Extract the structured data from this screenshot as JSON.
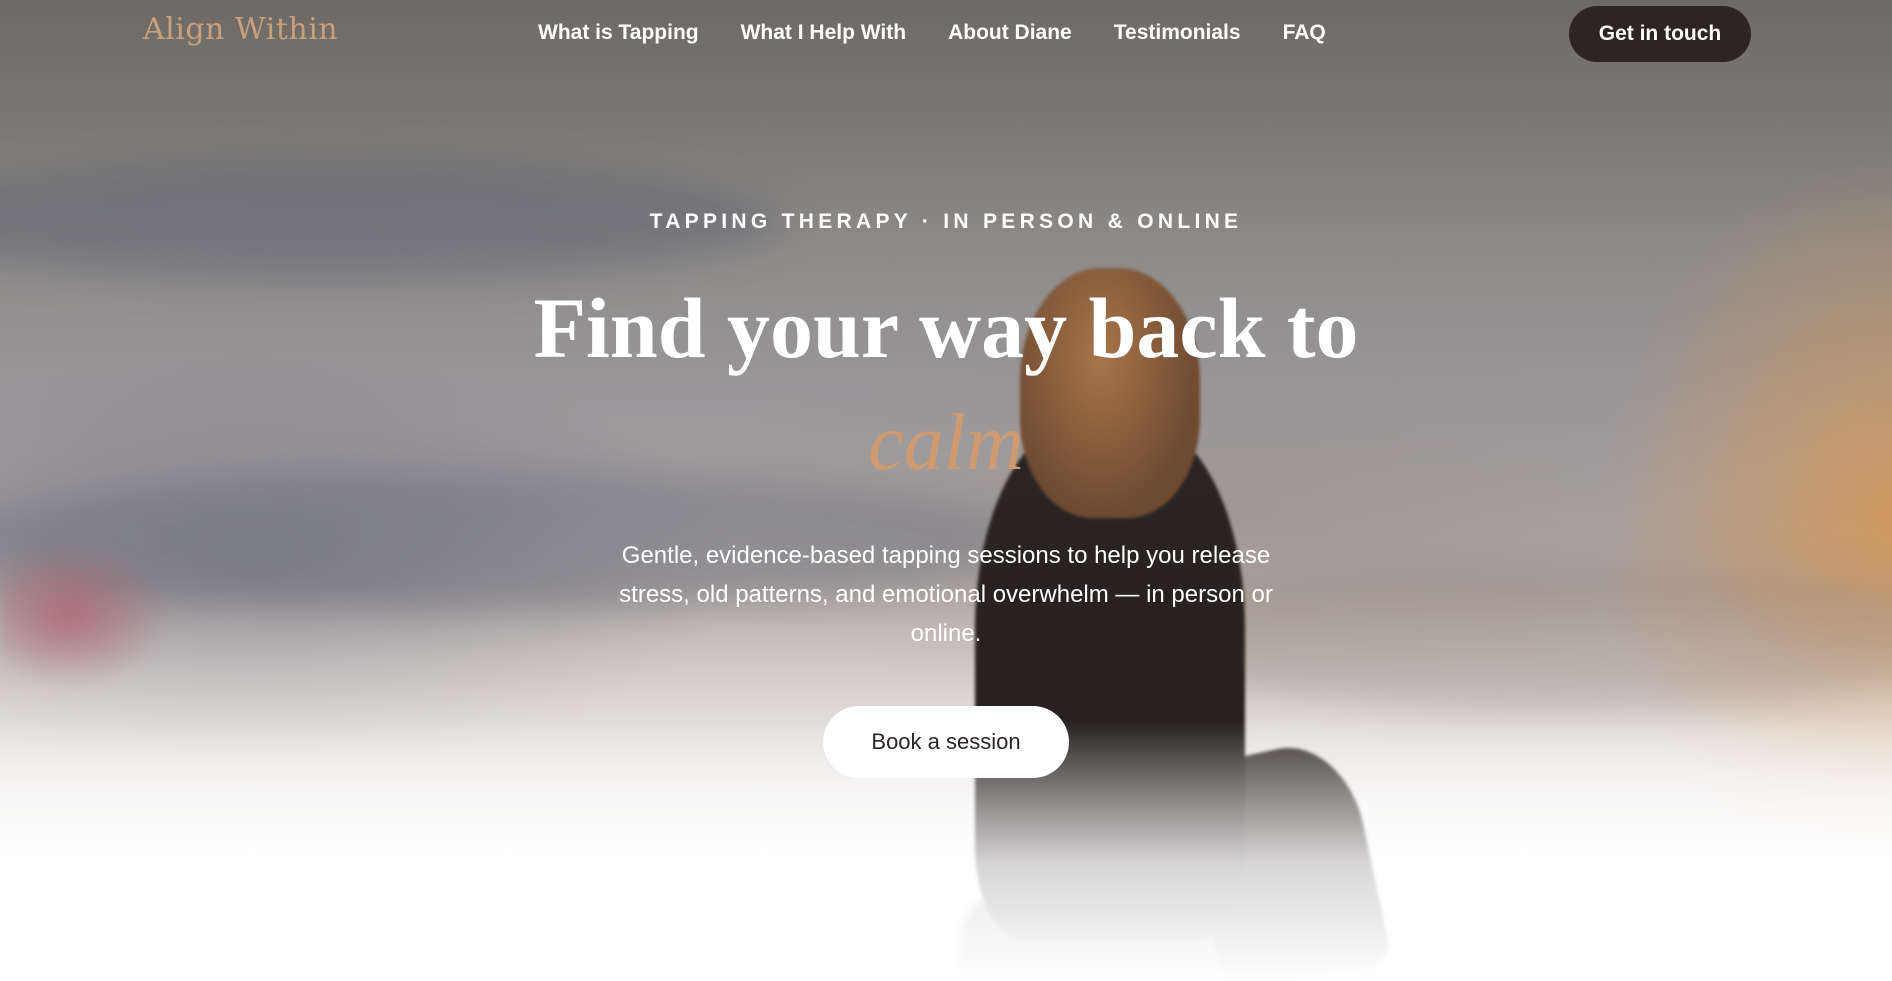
{
  "brand": {
    "logo_text": "Align Within",
    "accent_color": "#cf9a70",
    "dark_color": "#2d2522"
  },
  "nav": {
    "links": [
      "What is Tapping",
      "What I Help With",
      "About Diane",
      "Testimonials",
      "FAQ"
    ],
    "cta_label": "Get in touch"
  },
  "hero": {
    "eyebrow": "TAPPING THERAPY · IN PERSON & ONLINE",
    "headline": "Find your way back to",
    "headline_accent": "calm",
    "subtext": "Gentle, evidence-based tapping sessions to help you release stress, old patterns, and emotional overwhelm — in person or online.",
    "button_label": "Book a session"
  }
}
